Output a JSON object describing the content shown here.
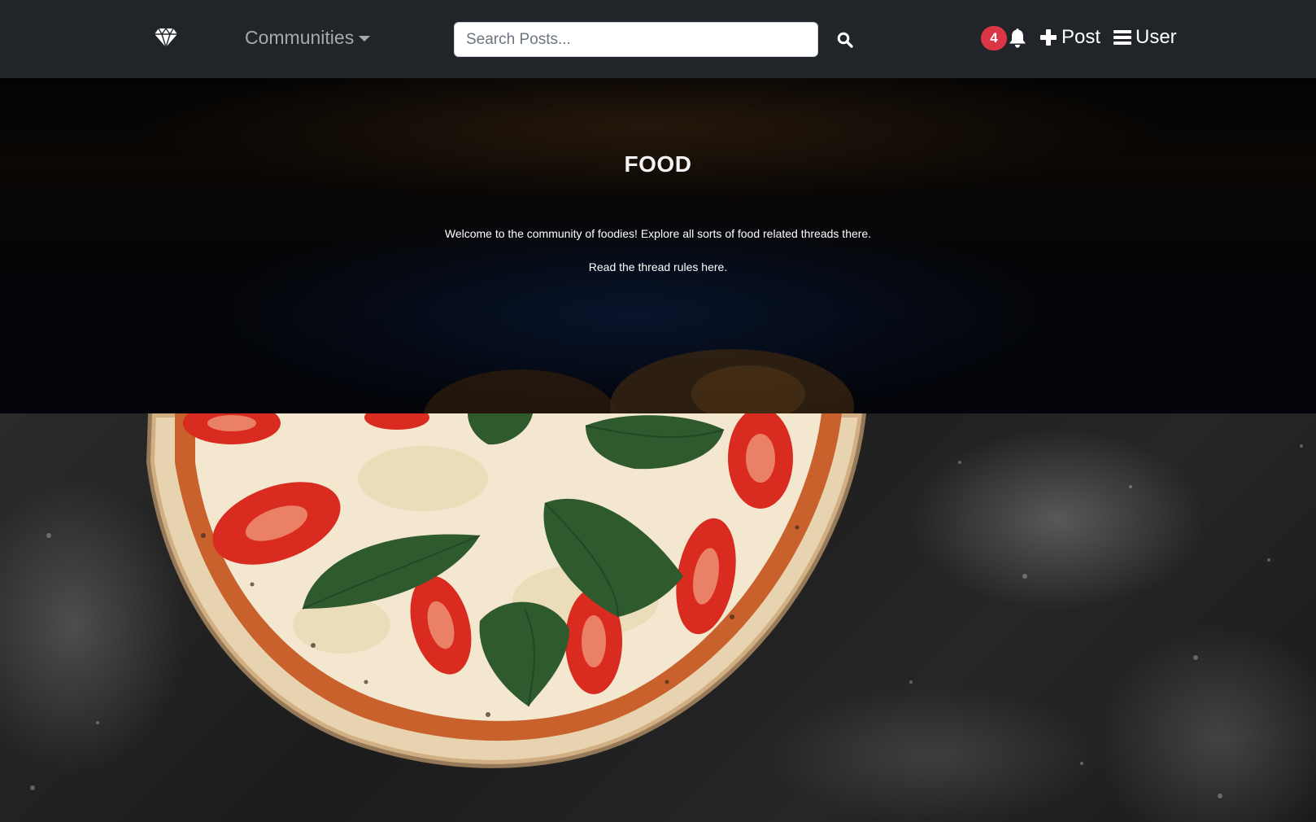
{
  "navbar": {
    "brand_icon": "gem-icon",
    "communities_label": "Communities",
    "search": {
      "placeholder": "Search Posts...",
      "value": ""
    },
    "search_icon": "search-icon",
    "notifications": {
      "count": "4",
      "icon": "bell-icon"
    },
    "post_label": "Post",
    "post_icon": "plus-icon",
    "user_label": "User",
    "user_icon": "bars-icon"
  },
  "hero": {
    "title": "FOOD",
    "description": "Welcome to the community of foodies! Explore all sorts of food related threads there.",
    "rules_text": "Read the thread rules here."
  },
  "banner": {
    "image": "pizza-on-floured-board"
  },
  "colors": {
    "navbar_bg": "#212529",
    "badge_bg": "#dc3545",
    "nav_muted": "#a6a9ad",
    "nav_text": "#ffffff"
  }
}
